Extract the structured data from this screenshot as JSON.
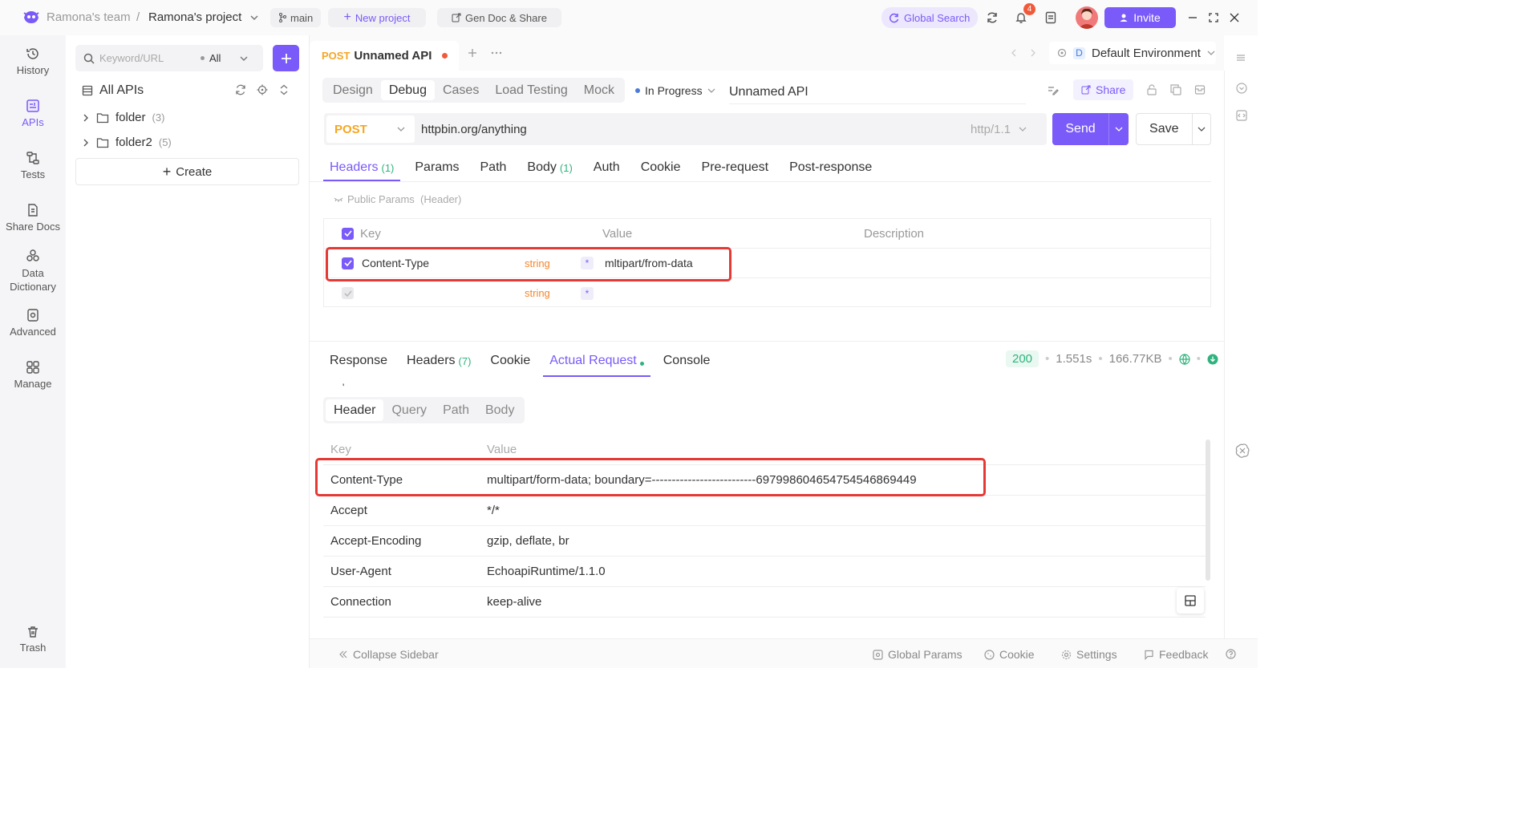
{
  "topbar": {
    "team": "Ramona's team",
    "separator": "/",
    "project": "Ramona's project",
    "branch": "main",
    "new_project": "New project",
    "gen_doc": "Gen Doc & Share",
    "global_search": "Global Search",
    "notifications_count": "4",
    "invite": "Invite"
  },
  "rail": {
    "items": [
      {
        "label": "History",
        "icon": "history-icon"
      },
      {
        "label": "APIs",
        "icon": "apis-icon"
      },
      {
        "label": "Tests",
        "icon": "tests-icon"
      },
      {
        "label": "Share Docs",
        "icon": "share-docs-icon"
      },
      {
        "label": "Data Dictionary",
        "icon": "data-dictionary-icon"
      },
      {
        "label": "Advanced",
        "icon": "advanced-icon"
      },
      {
        "label": "Manage",
        "icon": "manage-icon"
      }
    ],
    "trash": "Trash"
  },
  "tree": {
    "search_placeholder": "Keyword/URL",
    "filter": "All",
    "all_apis": "All APIs",
    "folders": [
      {
        "name": "folder",
        "count": "(3)"
      },
      {
        "name": "folder2",
        "count": "(5)"
      }
    ],
    "create": "Create"
  },
  "main": {
    "tab": {
      "method": "POST",
      "title": "Unnamed API"
    },
    "environment": {
      "badge": "D",
      "name": "Default Environment"
    },
    "modes": [
      "Design",
      "Debug",
      "Cases",
      "Load Testing",
      "Mock"
    ],
    "status": "In Progress",
    "api_name": "Unnamed API",
    "share": "Share",
    "method": "POST",
    "url": "httpbin.org/anything",
    "protocol": "http/1.1",
    "send": "Send",
    "save": "Save",
    "request_tabs": [
      {
        "label": "Headers",
        "count": "(1)"
      },
      {
        "label": "Params",
        "count": ""
      },
      {
        "label": "Path",
        "count": ""
      },
      {
        "label": "Body",
        "count": "(1)"
      },
      {
        "label": "Auth",
        "count": ""
      },
      {
        "label": "Cookie",
        "count": ""
      },
      {
        "label": "Pre-request",
        "count": ""
      },
      {
        "label": "Post-response",
        "count": ""
      }
    ],
    "public_params": "Public Params  (Header)",
    "header_columns": {
      "key": "Key",
      "value": "Value",
      "description": "Description"
    },
    "headers": [
      {
        "key": "Content-Type",
        "type": "string",
        "required": "*",
        "value": "mltipart/from-data"
      },
      {
        "key": "",
        "type": "string",
        "required": "*",
        "value": ""
      }
    ]
  },
  "response": {
    "tabs": [
      {
        "label": "Response",
        "count": ""
      },
      {
        "label": "Headers",
        "count": "(7)"
      },
      {
        "label": "Cookie",
        "count": ""
      },
      {
        "label": "Actual Request",
        "count": ""
      },
      {
        "label": "Console",
        "count": ""
      }
    ],
    "status_code": "200",
    "time": "1.551s",
    "size": "166.77KB",
    "subtabs": [
      "Header",
      "Query",
      "Path",
      "Body"
    ],
    "columns": {
      "key": "Key",
      "value": "Value"
    },
    "rows": [
      {
        "key": "Content-Type",
        "value": "multipart/form-data; boundary=--------------------------697998604654754546869449"
      },
      {
        "key": "Accept",
        "value": "*/*"
      },
      {
        "key": "Accept-Encoding",
        "value": "gzip, deflate, br"
      },
      {
        "key": "User-Agent",
        "value": "EchoapiRuntime/1.1.0"
      },
      {
        "key": "Connection",
        "value": "keep-alive"
      }
    ]
  },
  "footer": {
    "collapse": "Collapse Sidebar",
    "global_params": "Global Params",
    "cookie": "Cookie",
    "settings": "Settings",
    "feedback": "Feedback"
  },
  "colors": {
    "accent": "#7a5af8",
    "method": "#f5a623",
    "success": "#2fb37e",
    "highlight": "#e53935"
  }
}
